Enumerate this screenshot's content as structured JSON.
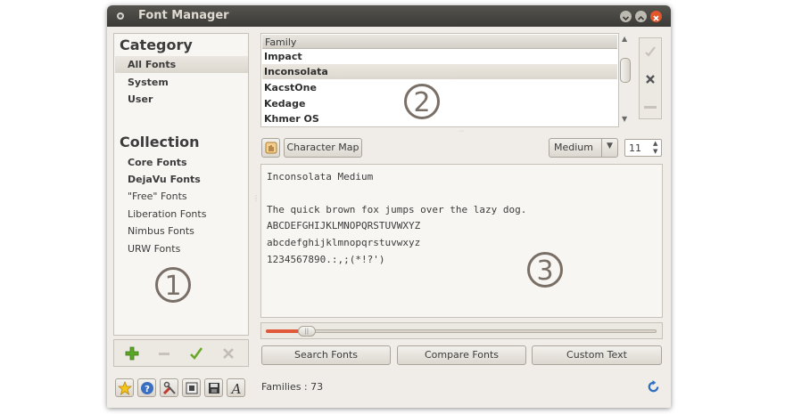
{
  "window": {
    "title": "Font Manager"
  },
  "sidebar": {
    "category_heading": "Category",
    "categories": [
      "All Fonts",
      "System",
      "User"
    ],
    "collection_heading": "Collection",
    "collections": [
      "Core Fonts",
      "DejaVu Fonts",
      "\"Free\" Fonts",
      "Liberation Fonts",
      "Nimbus Fonts",
      "URW Fonts"
    ]
  },
  "family_list": {
    "header": "Family",
    "items": [
      "Impact",
      "Inconsolata",
      "KacstOne",
      "Kedage",
      "Khmer OS"
    ],
    "selected": "Inconsolata"
  },
  "toolbar": {
    "character_map_label": "Character Map",
    "style_select": "Medium",
    "size_value": "11"
  },
  "preview": {
    "title_line": "Inconsolata Medium",
    "sentence": "The quick brown fox jumps over the lazy dog.",
    "upper": "ABCDEFGHIJKLMNOPQRSTUVWXYZ",
    "lower": "abcdefghijklmnopqrstuvwxyz",
    "digits": "1234567890.:,;(*!?')"
  },
  "slider": {
    "value_fraction": 0.1
  },
  "buttons": {
    "search": "Search Fonts",
    "compare": "Compare Fonts",
    "custom": "Custom Text"
  },
  "status": {
    "families": "Families : 73"
  },
  "annotations": {
    "one": "1",
    "two": "2",
    "three": "3"
  },
  "icons": {
    "menu": "window-menu-icon",
    "minimize": "minimize-icon",
    "maximize": "maximize-icon",
    "close": "close-icon",
    "add": "plus-icon",
    "remove": "minus-icon",
    "enable": "check-icon",
    "disable": "x-icon",
    "favorites": "star-icon",
    "help": "help-icon",
    "prefs": "tools-icon",
    "export": "export-icon",
    "save": "floppy-icon",
    "fonts": "font-icon",
    "refresh": "refresh-icon"
  },
  "colors": {
    "title_bg": "#3b3a36",
    "close": "#e2572b",
    "accent_red": "#e05a3a",
    "add_green": "#5aa625"
  }
}
